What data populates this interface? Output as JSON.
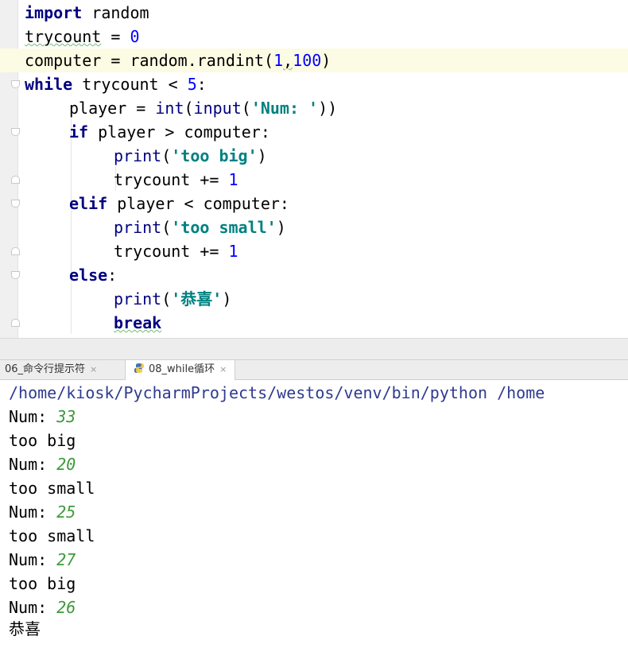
{
  "editor": {
    "lines": {
      "l1": {
        "kw": "import",
        "rest": " random"
      },
      "l2": {
        "name": "trycount",
        "op": " = ",
        "num": "0"
      },
      "l3": {
        "pre": "computer = random.randint(",
        "n1": "1",
        "comma": ",",
        "n2": "100",
        "post": ")"
      },
      "l4": {
        "kw": "while",
        "rest": " trycount < ",
        "num": "5",
        "post": ":"
      },
      "l5": {
        "pre": "player = ",
        "int": "int",
        "p1": "(",
        "input": "input",
        "p2": "(",
        "str": "'Num: '",
        "post": "))"
      },
      "l6": {
        "kw": "if",
        "rest": " player > computer:"
      },
      "l7": {
        "fn": "print",
        "p1": "(",
        "str": "'too big'",
        "post": ")"
      },
      "l8": {
        "pre": "trycount += ",
        "num": "1"
      },
      "l9": {
        "kw": "elif",
        "rest": " player < computer:"
      },
      "l10": {
        "fn": "print",
        "p1": "(",
        "str": "'too small'",
        "post": ")"
      },
      "l11": {
        "pre": "trycount += ",
        "num": "1"
      },
      "l12": {
        "kw": "else",
        "post": ":"
      },
      "l13": {
        "fn": "print",
        "p1": "(",
        "str": "'恭喜'",
        "post": ")"
      },
      "l14": {
        "kw": "break"
      }
    }
  },
  "tabs": [
    {
      "label": "06_命令行提示符",
      "close": "×"
    },
    {
      "label": "08_while循环",
      "close": "×"
    }
  ],
  "console": {
    "path": "/home/kiosk/PycharmProjects/westos/venv/bin/python /home",
    "prompt": "Num: ",
    "inputs": [
      "33",
      "20",
      "25",
      "27",
      "26"
    ],
    "responses": [
      "too big",
      "too small",
      "too small",
      "too big"
    ],
    "final": "恭喜"
  },
  "colors": {
    "keyword": "#000080",
    "number": "#0000ff",
    "string": "#008080",
    "input": "#3c9a3c",
    "path": "#2f3b8f"
  }
}
